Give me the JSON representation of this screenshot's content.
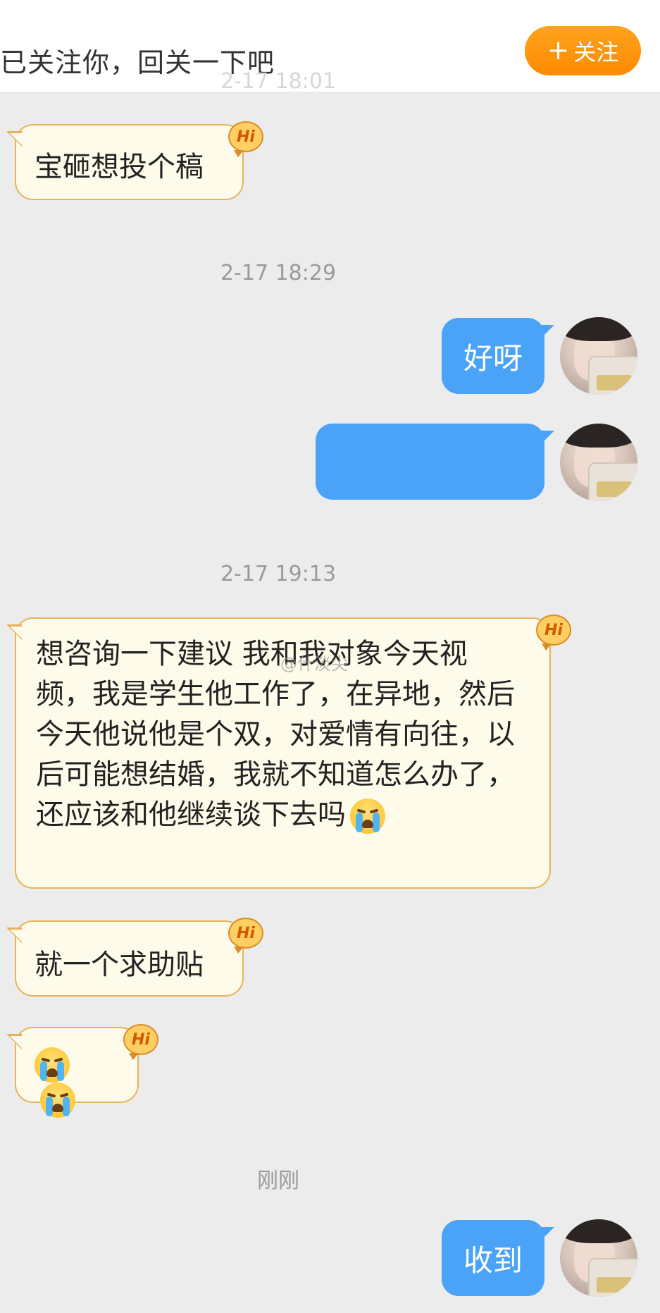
{
  "follow_bar": {
    "text": "已关注你，回关一下吧",
    "button_label": "关注",
    "button_icon": "plus-icon",
    "button_color": "#ff9500"
  },
  "timestamps": {
    "ghost": "2-17 18:01",
    "t1": "2-17 18:29",
    "t2": "2-17 19:13",
    "t3": "刚刚"
  },
  "messages": {
    "m1": "宝砸想投个稿",
    "m2": "好呀",
    "m3": "",
    "m4": "想咨询一下建议 我和我对象今天视频，我是学生他工作了，在异地，然后今天他说他是个双，对爱情有向往，以后可能想结婚，我就不知道怎么办了，还应该和他继续谈下去吗",
    "m5": "就一个求助贴",
    "m7": "收到"
  },
  "badge_text": "Hi",
  "watermark": "@什淡尖",
  "colors": {
    "sent_bubble": "#4aa3f7",
    "received_bubble": "#fffbeb",
    "received_border": "#e9b25a",
    "background": "#ececec"
  }
}
